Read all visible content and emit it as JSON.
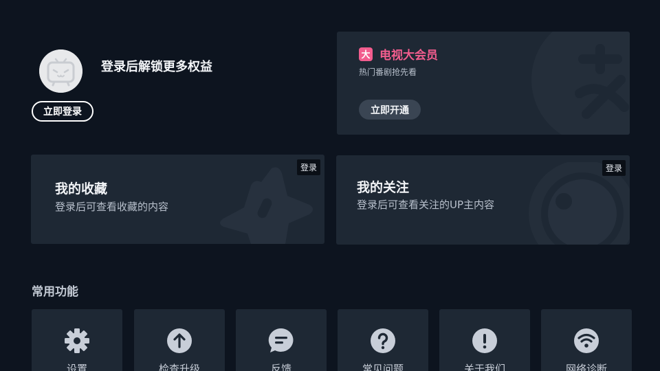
{
  "profile": {
    "prompt_text": "登录后解锁更多权益",
    "login_button": "立即登录"
  },
  "vip": {
    "badge": "大",
    "title": "电视大会员",
    "subtitle": "热门番剧抢先看",
    "open_button": "立即开通"
  },
  "favorites": {
    "title": "我的收藏",
    "description": "登录后可查看收藏的内容",
    "tag": "登录"
  },
  "following": {
    "title": "我的关注",
    "description": "登录后可查看关注的UP主内容",
    "tag": "登录"
  },
  "common_functions": {
    "title": "常用功能",
    "items": [
      {
        "label": "设置",
        "icon": "gear-icon"
      },
      {
        "label": "检查升级",
        "icon": "arrow-up-icon"
      },
      {
        "label": "反馈",
        "icon": "chat-bubble-icon"
      },
      {
        "label": "常见问题",
        "icon": "question-icon"
      },
      {
        "label": "关于我们",
        "icon": "exclamation-icon"
      },
      {
        "label": "网络诊断",
        "icon": "wifi-icon"
      }
    ]
  },
  "colors": {
    "background": "#0d141f",
    "card": "#1e2834",
    "vip_accent": "#f25d8e",
    "icon": "#c8ced8"
  }
}
